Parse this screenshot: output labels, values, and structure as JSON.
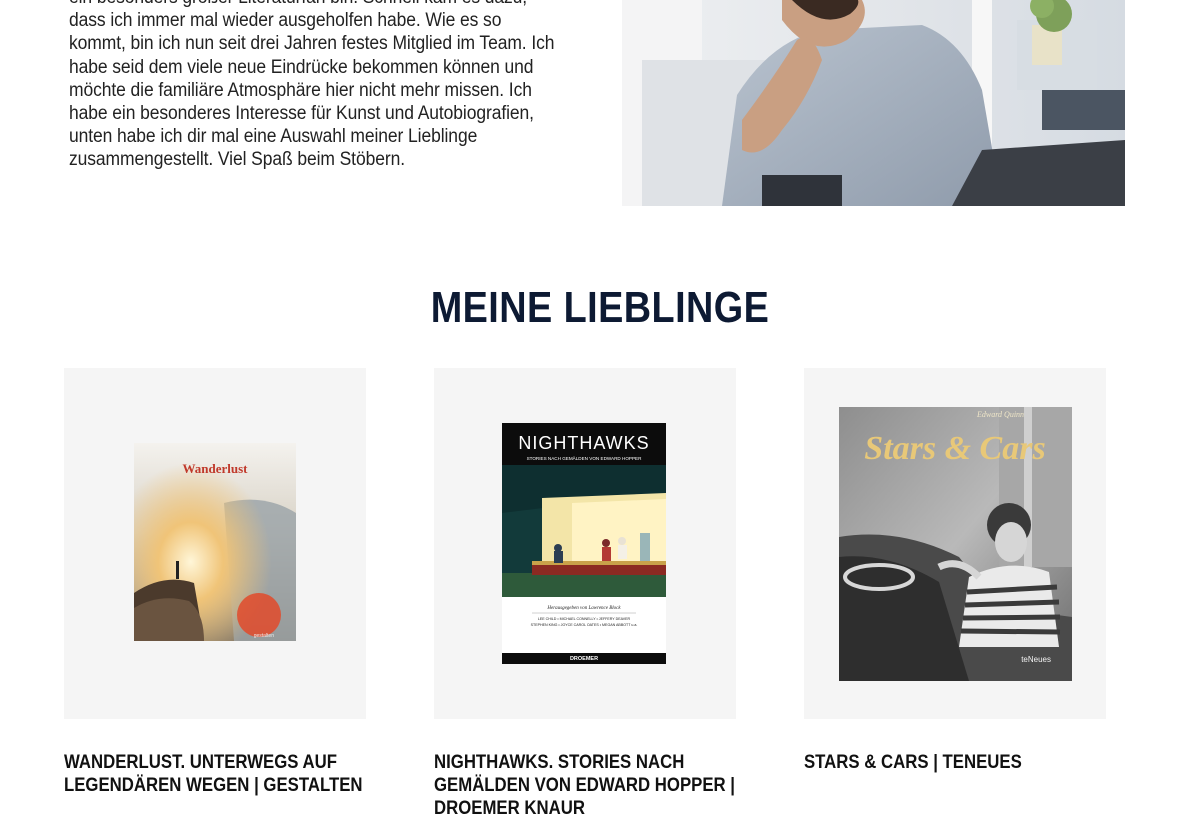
{
  "intro": {
    "lines": [
      "ein besonders großer Literaturfan bin. Schnell kam es dazu,",
      "dass ich immer mal wieder ausgeholfen habe. Wie es so",
      "kommt, bin ich nun seit drei Jahren festes Mitglied im Team. Ich",
      "habe seid dem viele neue Eindrücke bekommen können und",
      "möchte die familiäre Atmosphäre hier nicht mehr missen. Ich",
      "habe ein besonderes Interesse für Kunst und Autobiografien,",
      "unten habe ich dir mal eine Auswahl meiner Lieblinge",
      "zusammengestellt. Viel Spaß beim Stöbern."
    ]
  },
  "section": {
    "title": "MEINE LIEBLINGE"
  },
  "products": [
    {
      "title_lines": [
        "WANDERLUST. UNTERWEGS AUF",
        "LEGENDÄREN WEGEN | GESTALTEN"
      ],
      "cover": {
        "title": "Wanderlust",
        "publisher": "gestalten"
      }
    },
    {
      "title_lines": [
        "NIGHTHAWKS. STORIES NACH",
        "GEMÄLDEN VON EDWARD HOPPER |",
        "DROEMER KNAUR"
      ],
      "cover": {
        "title": "NIGHTHAWKS",
        "subtitle": "STORIES NACH GEMÄLDEN VON EDWARD HOPPER",
        "editor": "Herausgegeben von Lawrence Block",
        "authors_1": "LEE CHILD • MICHAEL CONNELLY • JEFFERY DEAVER",
        "authors_2": "STEPHEN KING • JOYCE CAROL OATES • MEGAN ABBOTT u.a.",
        "publisher": "DROEMER"
      }
    },
    {
      "title_lines": [
        "STARS & CARS | TENEUES"
      ],
      "cover": {
        "author": "Edward Quinn",
        "title": "Stars & Cars",
        "publisher": "teNeues"
      }
    }
  ],
  "colors": {
    "heading": "#0d1a33",
    "card_bg": "#f5f5f5",
    "stars_gold": "#e8c878"
  }
}
